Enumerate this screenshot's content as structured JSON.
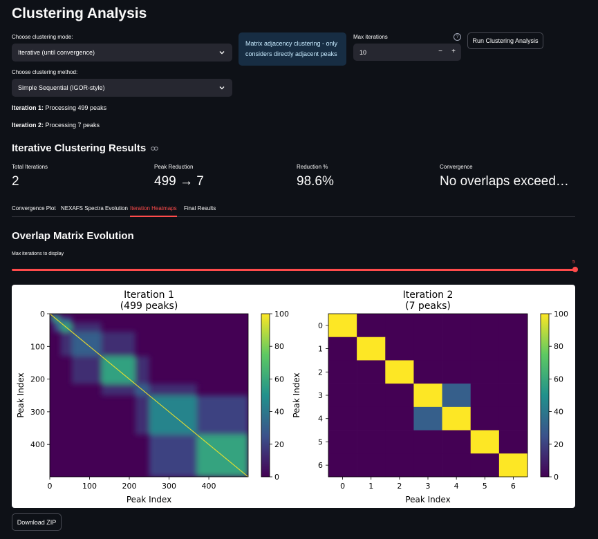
{
  "page": {
    "title": "Clustering Analysis"
  },
  "controls": {
    "mode_label": "Choose clustering mode:",
    "mode_value": "Iterative (until convergence)",
    "method_label": "Choose clustering method:",
    "method_value": "Simple Sequential (IGOR-style)",
    "info_text": "Matrix adjacency clustering - only considers directly adjacent peaks",
    "max_iter_label": "Max iterations",
    "max_iter_value": "10",
    "minus": "−",
    "plus": "+",
    "help": "?",
    "run_button": "Run Clustering Analysis"
  },
  "log": [
    {
      "bold": "Iteration 1:",
      "text": " Processing 499 peaks"
    },
    {
      "bold": "Iteration 2:",
      "text": " Processing 7 peaks"
    }
  ],
  "results": {
    "heading": "Iterative Clustering Results",
    "metrics": [
      {
        "label": "Total Iterations",
        "value": "2"
      },
      {
        "label": "Peak Reduction",
        "value": "499 → 7"
      },
      {
        "label": "Reduction %",
        "value": "98.6%"
      },
      {
        "label": "Convergence",
        "value": "No overlaps exceed…"
      }
    ]
  },
  "tabs": [
    {
      "label": "Convergence Plot",
      "active": false
    },
    {
      "label": "NEXAFS Spectra Evolution",
      "active": false
    },
    {
      "label": "Iteration Heatmaps",
      "active": true
    },
    {
      "label": "Final Results",
      "active": false
    }
  ],
  "heatmaps": {
    "heading": "Overlap Matrix Evolution",
    "slider_label": "Max iterations to display",
    "slider_value": "5",
    "slider_fraction": 1.0,
    "download_button": "Download ZIP"
  },
  "colors": {
    "accent": "#ff4b4b",
    "background": "#0e1117",
    "widget": "#262730",
    "info_bg": "#172d43",
    "info_text": "#c7ebff"
  },
  "chart_data": [
    {
      "type": "heatmap",
      "title": "Iteration 1",
      "subtitle": "(499 peaks)",
      "xlabel": "Peak Index",
      "ylabel": "Peak Index",
      "x_ticks": [
        0,
        100,
        200,
        300,
        400
      ],
      "y_ticks": [
        0,
        100,
        200,
        300,
        400
      ],
      "xlim": [
        0,
        499
      ],
      "ylim": [
        0,
        499
      ],
      "colorbar": {
        "min": 0,
        "max": 100,
        "ticks": [
          0,
          20,
          40,
          60,
          80,
          100
        ]
      },
      "colormap": "viridis",
      "diagonal_value": 100,
      "approx_blocks": [
        {
          "start": 0,
          "end": 10,
          "value": 60
        },
        {
          "start": 10,
          "end": 27,
          "value": 58
        },
        {
          "start": 27,
          "end": 55,
          "value": 56
        },
        {
          "start": 55,
          "end": 130,
          "value": 30
        },
        {
          "start": 130,
          "end": 215,
          "value": 57
        },
        {
          "start": 215,
          "end": 250,
          "value": 30
        },
        {
          "start": 250,
          "end": 370,
          "value": 45
        },
        {
          "start": 370,
          "end": 499,
          "value": 58
        }
      ]
    },
    {
      "type": "heatmap",
      "title": "Iteration 2",
      "subtitle": "(7 peaks)",
      "xlabel": "Peak Index",
      "ylabel": "Peak Index",
      "x_ticks": [
        0,
        1,
        2,
        3,
        4,
        5,
        6
      ],
      "y_ticks": [
        0,
        1,
        2,
        3,
        4,
        5,
        6
      ],
      "colorbar": {
        "min": 0,
        "max": 100,
        "ticks": [
          0,
          20,
          40,
          60,
          80,
          100
        ]
      },
      "colormap": "viridis",
      "matrix": [
        [
          100,
          0,
          0,
          0,
          0,
          0,
          0
        ],
        [
          0,
          100,
          0,
          0,
          0,
          0,
          0
        ],
        [
          0,
          0,
          100,
          0,
          0,
          0,
          0
        ],
        [
          0,
          0,
          0,
          100,
          30,
          0,
          0
        ],
        [
          0,
          0,
          0,
          30,
          100,
          0,
          0
        ],
        [
          0,
          0,
          0,
          0,
          0,
          100,
          0
        ],
        [
          0,
          0,
          0,
          0,
          0,
          0,
          100
        ]
      ]
    }
  ]
}
